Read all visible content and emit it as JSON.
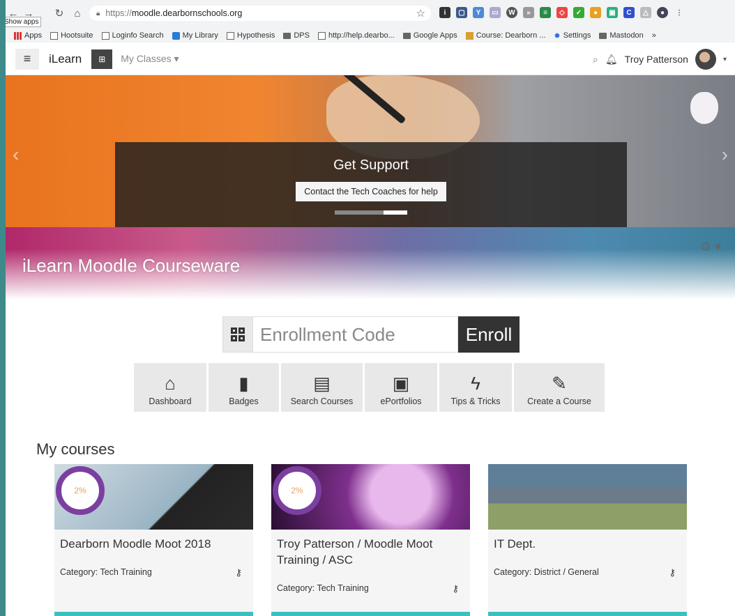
{
  "browser": {
    "url_proto": "https://",
    "url_host": "moodle.dearbornschools.org",
    "tooltip": "Show apps",
    "bookmarks": [
      {
        "label": "Apps",
        "icon": "apps"
      },
      {
        "label": "Hootsuite",
        "icon": "page"
      },
      {
        "label": "Loginfo Search",
        "icon": "page"
      },
      {
        "label": "My Library",
        "icon": "page"
      },
      {
        "label": "Hypothesis",
        "icon": "page"
      },
      {
        "label": "DPS",
        "icon": "folder"
      },
      {
        "label": "http://help.dearbo...",
        "icon": "page"
      },
      {
        "label": "Google Apps",
        "icon": "folder"
      },
      {
        "label": "Course: Dearborn ...",
        "icon": "page"
      },
      {
        "label": "Settings",
        "icon": "gear"
      },
      {
        "label": "Mastodon",
        "icon": "folder"
      },
      {
        "label": "»",
        "icon": "none"
      }
    ]
  },
  "navbar": {
    "brand": "iLearn",
    "classes_label": "My Classes ▾",
    "user_name": "Troy Patterson"
  },
  "carousel": {
    "title": "Get Support",
    "button_label": "Contact the Tech Coaches for help"
  },
  "banner": {
    "title": "iLearn Moodle Courseware"
  },
  "enroll": {
    "placeholder": "Enrollment Code",
    "button_label": "Enroll"
  },
  "tiles": [
    {
      "label": "Dashboard",
      "icon": "home-icon",
      "glyph": "⌂"
    },
    {
      "label": "Badges",
      "icon": "bookmark-icon",
      "glyph": "▮"
    },
    {
      "label": "Search Courses",
      "icon": "book-icon",
      "glyph": "▤"
    },
    {
      "label": "ePortfolios",
      "icon": "id-card-icon",
      "glyph": "▣"
    },
    {
      "label": "Tips & Tricks",
      "icon": "bolt-icon",
      "glyph": "ϟ"
    },
    {
      "label": "Create a Course",
      "icon": "edit-icon",
      "glyph": "✎"
    }
  ],
  "courses_title": "My courses",
  "courses": [
    {
      "title": "Dearborn Moodle Moot 2018",
      "category_label": "Category:",
      "category": "Tech Training",
      "progress": "2%"
    },
    {
      "title": "Troy Patterson / Moodle Moot Training / ASC",
      "category_label": "Category:",
      "category": "Tech Training",
      "progress": "2%"
    },
    {
      "title": "IT Dept.",
      "category_label": "Category:",
      "category": "District / General",
      "progress": ""
    }
  ],
  "colors": {
    "accent": "#3bc0c0",
    "progress_ring": "#7b3fa0",
    "dark_button": "#333333"
  }
}
